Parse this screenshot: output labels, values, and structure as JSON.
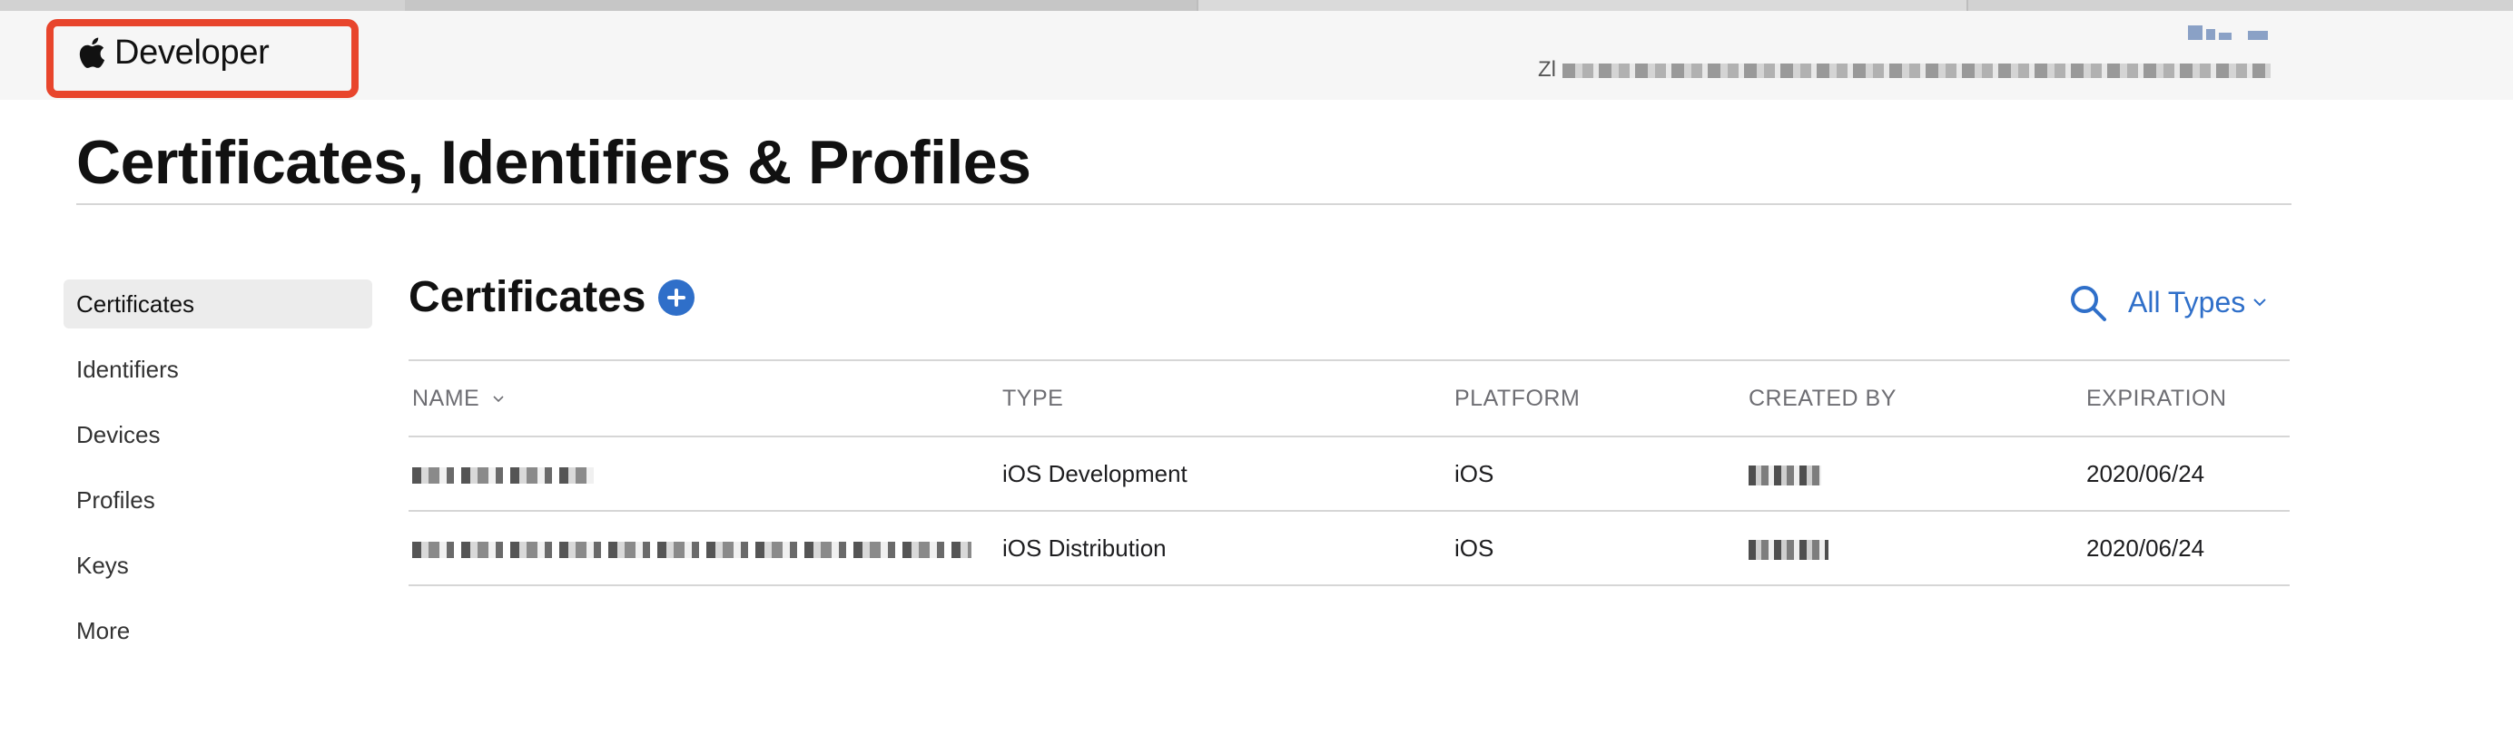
{
  "brand": {
    "text": "Developer"
  },
  "account": {
    "name_visible_prefix": "Zl"
  },
  "page": {
    "title": "Certificates, Identifiers & Profiles"
  },
  "sidebar": {
    "items": [
      {
        "label": "Certificates",
        "active": true
      },
      {
        "label": "Identifiers",
        "active": false
      },
      {
        "label": "Devices",
        "active": false
      },
      {
        "label": "Profiles",
        "active": false
      },
      {
        "label": "Keys",
        "active": false
      },
      {
        "label": "More",
        "active": false
      }
    ]
  },
  "main": {
    "section_title": "Certificates",
    "filter_label": "All Types",
    "accent_color": "#2f6fc9",
    "table": {
      "columns": [
        "NAME",
        "TYPE",
        "PLATFORM",
        "CREATED BY",
        "EXPIRATION"
      ],
      "rows": [
        {
          "name": "",
          "type": "iOS Development",
          "platform": "iOS",
          "created_by": "",
          "expiration": "2020/06/24"
        },
        {
          "name": "",
          "type": "iOS Distribution",
          "platform": "iOS",
          "created_by": "",
          "expiration": "2020/06/24"
        }
      ]
    }
  },
  "icons": {
    "brand": "apple-logo-icon",
    "add": "plus-circle-icon",
    "search": "search-icon",
    "filter": "chevron-down-icon",
    "sort": "chevron-down-icon",
    "account": "account-icon"
  },
  "highlight": {
    "color": "#e8452c",
    "target": "brand-logo"
  }
}
